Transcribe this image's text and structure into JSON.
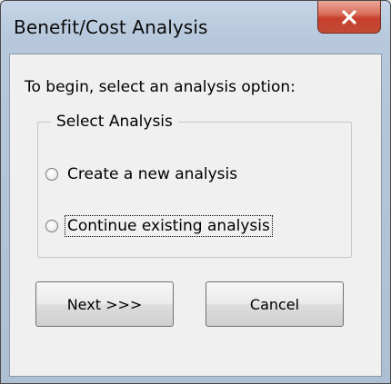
{
  "window": {
    "title": "Benefit/Cost Analysis"
  },
  "dialog": {
    "prompt": "To begin, select an analysis option:",
    "group_label": "Select Analysis",
    "options": [
      {
        "label": "Create a new analysis",
        "selected": false
      },
      {
        "label": "Continue existing analysis",
        "selected": false,
        "focused": true
      }
    ],
    "buttons": {
      "next": "Next >>>",
      "cancel": "Cancel"
    }
  },
  "icons": {
    "close": "close-icon"
  },
  "colors": {
    "close_button": "#c7402c",
    "title_bar": "#b7c8dc",
    "client_bg": "#f0f0f0"
  }
}
